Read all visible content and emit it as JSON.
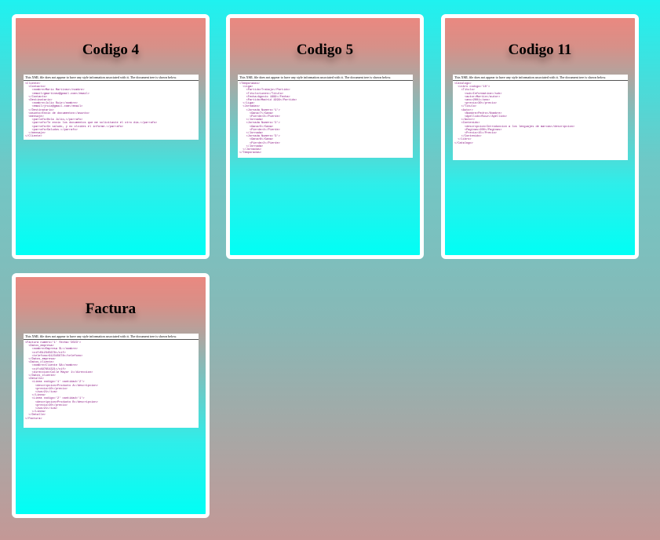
{
  "cards": [
    {
      "title": "Codigo 4",
      "preview_message": "This XML file does not appear to have any style information associated with it. The document tree is shown below.",
      "xml_lines": [
        "<Cliente>",
        "  <Contacto>",
        "    <nombre>Mario Martinez</nombre>",
        "    <email>gmartinez@gmail.com</email>",
        "  </Contacto>",
        "  <Destinatario>",
        "    <nombre>Julio Ruiz</nombre>",
        "    <email>jruiz@gmail.com</email>",
        "  </Destinatario>",
        "  <asunto>Envio de documentos</asunto>",
        "  <mensaje>",
        "    <parrafo>Hola Julio,</parrafo>",
        "    <parrafo>Te envio los documentos que me solicitaste el otro dia.</parrafo>",
        "    <parrafo>Un saludo, y no olvides el informe.</parrafo>",
        "    <parrafo>Saludos.</parrafo>",
        "  </mensaje>",
        "</Cliente>"
      ]
    },
    {
      "title": "Codigo 5",
      "preview_message": "This XML file does not appear to have any style information associated with it. The document tree is shown below.",
      "xml_lines": [
        "<Temporadas>",
        "  <Liga>",
        "    <Partido>Trabajo</Partido>",
        "    <Titulo>Lunes</Titulo>",
        "    <Fecha>Agosto 1999</Fecha>",
        "    <Partido>Madrid 1999</Partido>",
        "  </Liga>",
        "  <Jornadas>",
        "    <Jornada Numero='1'>",
        "      <Gana>7</Gana>",
        "      <Pierde>3</Pierde>",
        "    </Jornada>",
        "    <Jornada Numero='2'>",
        "      <Gana>5</Gana>",
        "      <Pierde>4</Pierde>",
        "    </Jornada>",
        "    <Jornada Numero='3'>",
        "      <Gana>6</Gana>",
        "      <Pierde>2</Pierde>",
        "    </Jornada>",
        "  </Jornadas>",
        "</Temporadas>"
      ]
    },
    {
      "title": "Codigo 11",
      "preview_message": "This XML file does not appear to have any style information associated with it. The document tree is shown below.",
      "xml_lines": [
        "<Catalogo>",
        "  <Libro codigo='10'>",
        "    <Titulo>",
        "      <sub>Informatica</sub>",
        "      <autor>Martin</autor>",
        "      <ano>2001</ano>",
        "      <precio>30</precio>",
        "    </Titulo>",
        "    <Autor>",
        "      <Nombre>Pedro</Nombre>",
        "      <Apellido>Ruiz</Apellido>",
        "    </Autor>",
        "    <Contenido>",
        "      <descripcion>Introduccion a los lenguajes de marcas</descripcion>",
        "      <Paginas>200</Paginas>",
        "      <Precio>15</Precio>",
        "    </Contenido>",
        "  </Libro>",
        "</Catalogo>"
      ]
    },
    {
      "title": "Factura",
      "preview_message": "This XML file does not appear to have any style information associated with it. The document tree is shown below.",
      "xml_lines": [
        "<Factura numero='1' fecha='2023'>",
        "  <Datos_empresa>",
        "    <nombre>Empresa SL</nombre>",
        "    <cif>B12345678</cif>",
        "    <telefono>912345678</telefono>",
        "  </Datos_empresa>",
        "  <Datos_cliente>",
        "    <nombre>Cliente SA</nombre>",
        "    <cif>A87654321</cif>",
        "    <direccion>Calle Mayor 1</direccion>",
        "  </Datos_cliente>",
        "  <Detalle>",
        "    <Linea codigo='1' cantidad='2'>",
        "      <descripcion>Producto A</descripcion>",
        "      <precio>10</precio>",
        "      <iva>21</iva>",
        "    </Linea>",
        "    <Linea codigo='2' cantidad='1'>",
        "      <descripcion>Producto B</descripcion>",
        "      <precio>20</precio>",
        "      <iva>21</iva>",
        "    </Linea>",
        "  </Detalle>",
        "</Factura>"
      ]
    }
  ]
}
